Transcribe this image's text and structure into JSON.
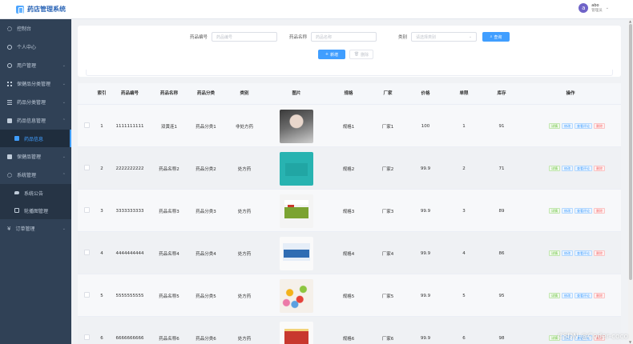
{
  "header": {
    "title": "药店管理系统",
    "user": {
      "avatar_letter": "a",
      "name": "abo",
      "role": "管理员"
    }
  },
  "sidebar": {
    "items": [
      {
        "label": "控制台",
        "icon": "dashboard-icon"
      },
      {
        "label": "个人中心",
        "icon": "user-icon"
      },
      {
        "label": "用户管理",
        "icon": "users-icon",
        "caret": "⌄"
      },
      {
        "label": "保健品分类管理",
        "icon": "grid-icon",
        "caret": "⌄"
      },
      {
        "label": "药品分类管理",
        "icon": "list-icon",
        "caret": "⌄"
      },
      {
        "label": "药品信息管理",
        "icon": "cart-icon",
        "caret": "⌃"
      },
      {
        "label": "药品信息",
        "icon": "cart-icon",
        "sub": true,
        "active": true
      },
      {
        "label": "保健品管理",
        "icon": "cart-icon",
        "caret": "⌄"
      },
      {
        "label": "系统管理",
        "icon": "gear-icon",
        "caret": "⌃"
      },
      {
        "label": "系统公告",
        "icon": "chat-icon",
        "sub": true
      },
      {
        "label": "轮播图管理",
        "icon": "image-icon",
        "sub": true
      },
      {
        "label": "订单管理",
        "icon": "yen-icon",
        "caret": "⌄"
      }
    ]
  },
  "search": {
    "code_label": "药品编号",
    "code_placeholder": "药品编号",
    "name_label": "药品名称",
    "name_placeholder": "药品名称",
    "category_label": "类别",
    "category_placeholder": "请选择类别",
    "query_button": "查询",
    "add_button": "新增",
    "delete_button": "删除"
  },
  "table": {
    "headers": {
      "index": "索引",
      "code": "药品编号",
      "name": "药品名称",
      "category": "药品分类",
      "type": "类别",
      "image": "图片",
      "spec": "规格",
      "maker": "厂家",
      "price": "价格",
      "unit": "单限",
      "stock": "库存",
      "ops": "操作"
    },
    "ops": {
      "detail": "详情",
      "edit": "修改",
      "review": "查看评论",
      "delete": "删除"
    },
    "rows": [
      {
        "index": "1",
        "code": "1111111111",
        "name": "双黄连1",
        "category": "药品分类1",
        "type": "非处方药",
        "spec": "规格1",
        "maker": "厂家1",
        "price": "100",
        "unit": "1",
        "stock": "91",
        "image": "portrait"
      },
      {
        "index": "2",
        "code": "2222222222",
        "name": "药品名称2",
        "category": "药品分类2",
        "type": "处方药",
        "spec": "规格2",
        "maker": "厂家2",
        "price": "99.9",
        "unit": "2",
        "stock": "71",
        "image": "teal-box"
      },
      {
        "index": "3",
        "code": "3333333333",
        "name": "药品名称3",
        "category": "药品分类3",
        "type": "处方药",
        "spec": "规格3",
        "maker": "厂家3",
        "price": "99.9",
        "unit": "3",
        "stock": "89",
        "image": "green-box"
      },
      {
        "index": "4",
        "code": "4444444444",
        "name": "药品名称4",
        "category": "药品分类4",
        "type": "处方药",
        "spec": "规格4",
        "maker": "厂家4",
        "price": "99.9",
        "unit": "4",
        "stock": "86",
        "image": "blue-box"
      },
      {
        "index": "5",
        "code": "5555555555",
        "name": "药品名称5",
        "category": "药品分类5",
        "type": "处方药",
        "spec": "规格5",
        "maker": "厂家5",
        "price": "99.9",
        "unit": "5",
        "stock": "95",
        "image": "pills"
      },
      {
        "index": "6",
        "code": "6666666666",
        "name": "药品名称6",
        "category": "药品分类6",
        "type": "处方药",
        "spec": "规格6",
        "maker": "厂家6",
        "price": "99.9",
        "unit": "6",
        "stock": "98",
        "image": "red-box"
      }
    ]
  },
  "watermark": "CSDN @Coder-coco",
  "colors": {
    "primary": "#409eff",
    "sidebar_bg": "#304156",
    "success": "#67c23a",
    "danger": "#f56c6c"
  }
}
